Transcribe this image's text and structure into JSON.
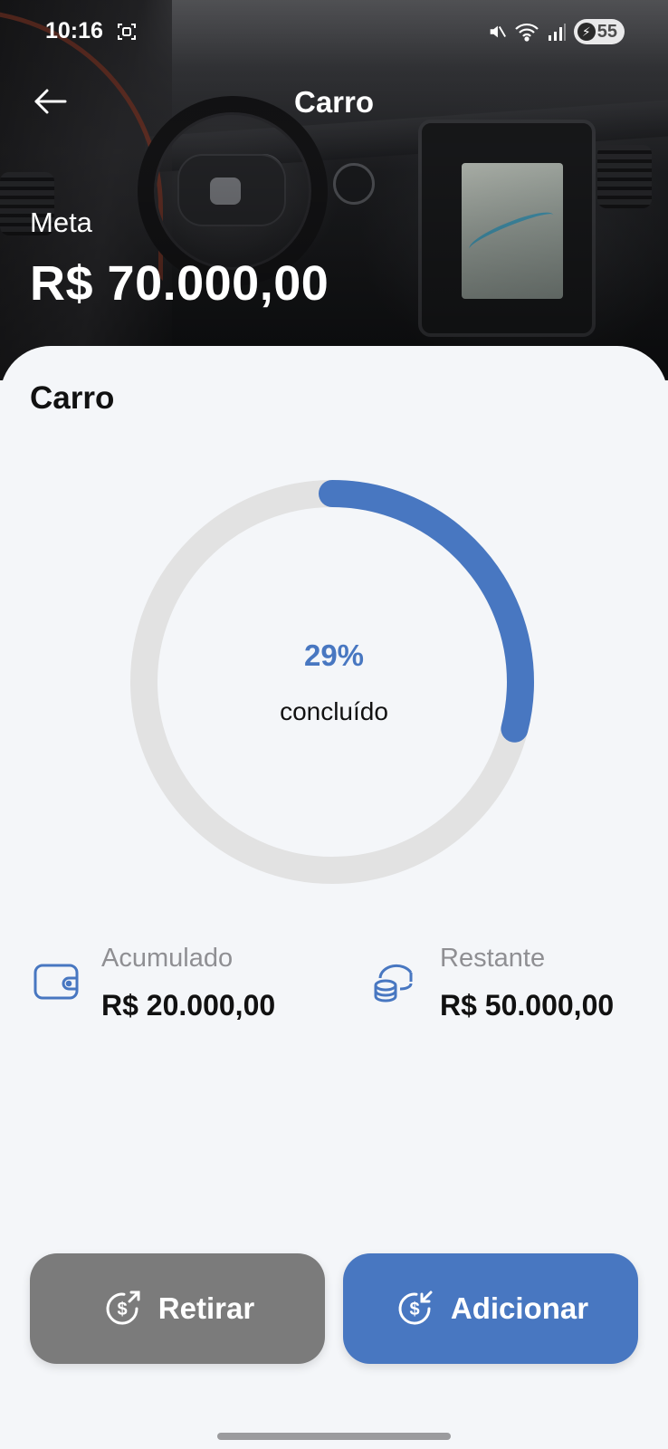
{
  "status_bar": {
    "time": "10:16",
    "battery": "55",
    "icons": [
      "screenshot-icon",
      "mute-icon",
      "wifi-icon",
      "signal-icon",
      "battery-charging-icon"
    ]
  },
  "header": {
    "title": "Carro",
    "back_icon": "arrow-left-icon",
    "goal_label": "Meta",
    "goal_value": "R$ 70.000,00",
    "background": "car-interior-photo"
  },
  "goal": {
    "name": "Carro",
    "progress": {
      "percent_label": "29%",
      "percent_value": 29,
      "caption": "concluído"
    },
    "stats": {
      "accumulated": {
        "label": "Acumulado",
        "value": "R$ 20.000,00",
        "icon": "wallet-icon"
      },
      "remaining": {
        "label": "Restante",
        "value": "R$ 50.000,00",
        "icon": "coins-icon"
      }
    }
  },
  "actions": {
    "withdraw": {
      "label": "Retirar",
      "icon": "money-out-icon"
    },
    "add": {
      "label": "Adicionar",
      "icon": "money-in-icon"
    }
  },
  "colors": {
    "accent": "#4877c1",
    "ring_track": "#e2e2e2",
    "withdraw_button": "#7b7b7b",
    "background": "#f4f6f9"
  }
}
